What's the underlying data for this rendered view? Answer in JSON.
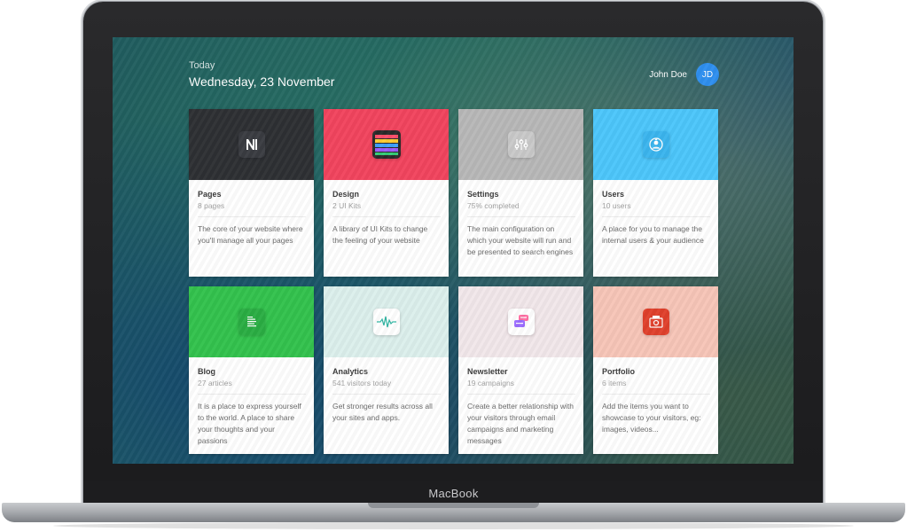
{
  "device": {
    "brand": "MacBook"
  },
  "header": {
    "today_label": "Today",
    "date": "Wednesday, 23 November",
    "user_name": "John Doe",
    "user_initials": "JD"
  },
  "colors": {
    "pages": "#2d2f33",
    "design": "#f2445e",
    "settings": "#b8b8b8",
    "users": "#4cc6fb",
    "blog": "#33c24d",
    "analytics": "#dcefec",
    "newsletter": "#f2e7ea",
    "portfolio": "#f7c5b8",
    "avatar": "#2e8ff0"
  },
  "cards": [
    {
      "icon": "pages-logo-icon",
      "title": "Pages",
      "meta": "8 pages",
      "desc": "The core of your website where you'll manage all your pages"
    },
    {
      "icon": "color-stripes-icon",
      "title": "Design",
      "meta": "2 UI Kits",
      "desc": "A library of UI Kits to change the feeling of your website"
    },
    {
      "icon": "sliders-icon",
      "title": "Settings",
      "meta": "75% completed",
      "desc": "The main configuration on which your website will run and be presented to search engines"
    },
    {
      "icon": "user-circle-icon",
      "title": "Users",
      "meta": "10 users",
      "desc": "A place for you to manage the internal users & your audience"
    },
    {
      "icon": "document-lines-icon",
      "title": "Blog",
      "meta": "27 articles",
      "desc": "It is a place to express yourself to the world. A place to share your thoughts and your passions"
    },
    {
      "icon": "waveform-icon",
      "title": "Analytics",
      "meta": "541 visitors today",
      "desc": "Get stronger results across all your sites and apps."
    },
    {
      "icon": "chat-bubbles-icon",
      "title": "Newsletter",
      "meta": "19 campaigns",
      "desc": "Create a better relationship with your visitors through email campaigns and marketing messages"
    },
    {
      "icon": "portfolio-images-icon",
      "title": "Portfolio",
      "meta": "6 items",
      "desc": "Add the items you want to showcase to your visitors, eg: images, videos..."
    }
  ]
}
